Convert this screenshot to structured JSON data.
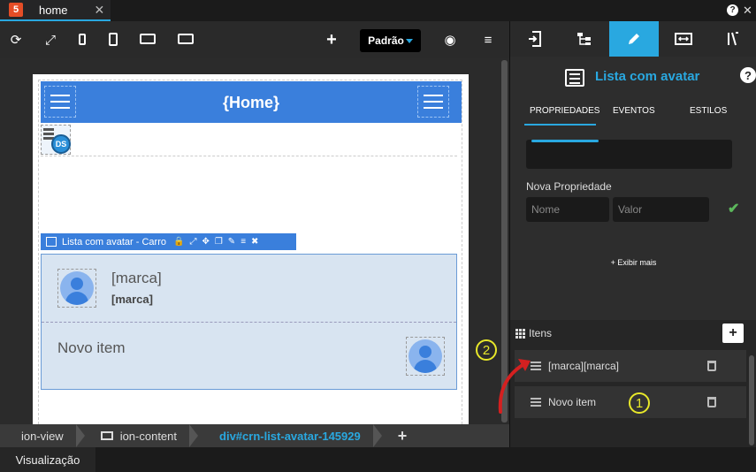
{
  "tab": {
    "icon_text": "5",
    "title": "home",
    "close": "✕"
  },
  "window": {
    "help": "?",
    "close": "✕"
  },
  "toolbar": {
    "refresh_icon": "⟳",
    "expand_icon": "⤢",
    "add_icon": "+",
    "preset_label": "Padrão",
    "preview_icon": "◉",
    "data_icon": "≡"
  },
  "page": {
    "header_title": "{Home}",
    "ds_label": "DS",
    "component_bar_label": "Lista com avatar - Carro",
    "component_bar_buttons": [
      "🔒",
      "⤢",
      "✥",
      "❐",
      "✎",
      "≡",
      "✖"
    ],
    "item1_title": "[marca]",
    "item1_subtitle": "[marca]",
    "item2_title": "Novo item"
  },
  "breadcrumb": {
    "items": [
      "ion-view",
      "ion-content",
      "div#crn-list-avatar-145929"
    ],
    "add": "+"
  },
  "status": {
    "visualizacao": "Visualização"
  },
  "right_panel": {
    "component_title": "Lista com avatar",
    "help": "?",
    "subtabs": [
      "PROPRIEDADES",
      "EVENTOS",
      "ESTILOS"
    ],
    "nova_propriedade_label": "Nova Propriedade",
    "nome_placeholder": "Nome",
    "valor_placeholder": "Valor",
    "check": "✔",
    "exibir_mais": "+ Exibir mais",
    "itens_label": "Itens",
    "add_item": "+",
    "items": [
      "[marca][marca]",
      "Novo item"
    ]
  },
  "annotations": {
    "badge1": "1",
    "badge2": "2"
  },
  "colors": {
    "accent": "#29a8e0",
    "header_blue": "#3a7fdc",
    "list_bg": "#d8e4f1",
    "badge": "#e8e82a",
    "arrow": "#d42020"
  }
}
